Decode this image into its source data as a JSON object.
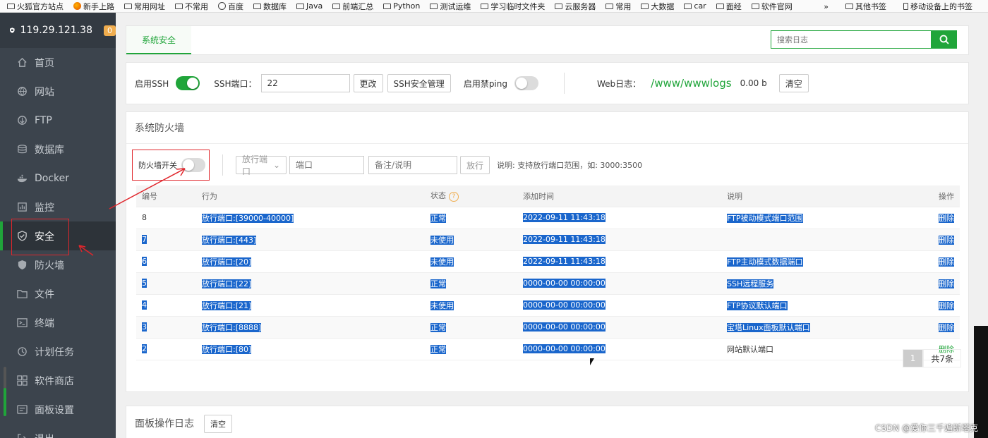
{
  "bookmarks": {
    "left": [
      "火狐官方站点",
      "新手上路",
      "常用网址",
      "不常用",
      "百度",
      "数据库",
      "Java",
      "前端汇总",
      "Python",
      "测试运维",
      "学习临时文件夹",
      "云服务器",
      "常用",
      "大数据",
      "car",
      "面经",
      "软件官网"
    ],
    "more": "»",
    "other": "其他书签",
    "mobile": "移动设备上的书签"
  },
  "sidebar": {
    "server_ip": "119.29.121.38",
    "badge": "0",
    "items": [
      {
        "label": "首页"
      },
      {
        "label": "网站"
      },
      {
        "label": "FTP"
      },
      {
        "label": "数据库"
      },
      {
        "label": "Docker"
      },
      {
        "label": "监控"
      },
      {
        "label": "安全"
      },
      {
        "label": "防火墙"
      },
      {
        "label": "文件"
      },
      {
        "label": "终端"
      },
      {
        "label": "计划任务"
      },
      {
        "label": "软件商店"
      },
      {
        "label": "面板设置"
      },
      {
        "label": "退出"
      }
    ]
  },
  "tabs": {
    "active": "系统安全"
  },
  "search": {
    "placeholder": "搜索日志"
  },
  "ssh": {
    "enable_label": "启用SSH",
    "port_label": "SSH端口：",
    "port_value": "22",
    "change_button": "更改",
    "manage_button": "SSH安全管理",
    "ping_label": "启用禁ping",
    "weblog_label": "Web日志：",
    "weblog_path": "/www/wwwlogs",
    "weblog_size": "0.00 b",
    "clear_button": "清空"
  },
  "firewall": {
    "title": "系统防火墙",
    "switch_label": "防火墙开关",
    "action_select": "放行端口",
    "port_placeholder": "端口",
    "note_placeholder": "备注/说明",
    "allow_button": "放行",
    "hint": "说明: 支持放行端口范围，如: 3000:3500",
    "columns": [
      "编号",
      "行为",
      "状态",
      "添加时间",
      "说明",
      "操作"
    ],
    "rows": [
      {
        "id": "8",
        "action": "放行端口:[39000-40000]",
        "status": "正常",
        "time": "2022-09-11 11:43:18",
        "note": "FTP被动模式端口范围",
        "op": "删除"
      },
      {
        "id": "7",
        "action": "放行端口:[443]",
        "status": "未使用",
        "time": "2022-09-11 11:43:18",
        "note": "",
        "op": "删除"
      },
      {
        "id": "6",
        "action": "放行端口:[20]",
        "status": "未使用",
        "time": "2022-09-11 11:43:18",
        "note": "FTP主动模式数据端口",
        "op": "删除"
      },
      {
        "id": "5",
        "action": "放行端口:[22]",
        "status": "正常",
        "time": "0000-00-00 00:00:00",
        "note": "SSH远程服务",
        "op": "删除"
      },
      {
        "id": "4",
        "action": "放行端口:[21]",
        "status": "未使用",
        "time": "0000-00-00 00:00:00",
        "note": "FTP协议默认端口",
        "op": "删除"
      },
      {
        "id": "3",
        "action": "放行端口:[8888]",
        "status": "正常",
        "time": "0000-00-00 00:00:00",
        "note": "宝塔Linux面板默认端口",
        "op": "删除"
      },
      {
        "id": "2",
        "action": "放行端口:[80]",
        "status": "正常",
        "time": "0000-00-00 00:00:00",
        "note": "网站默认端口",
        "op": "删除"
      }
    ],
    "pager_current": "1",
    "pager_total": "共7条"
  },
  "panel_log": {
    "title": "面板操作日志",
    "clear_button": "清空"
  },
  "watermark": "CSDN @爱你三千遍斯塔克",
  "colors": {
    "brand_green": "#20a53a",
    "sidebar_bg": "#3c444d",
    "selection_blue": "#1a66cc",
    "annotation_red": "#e0262c"
  }
}
